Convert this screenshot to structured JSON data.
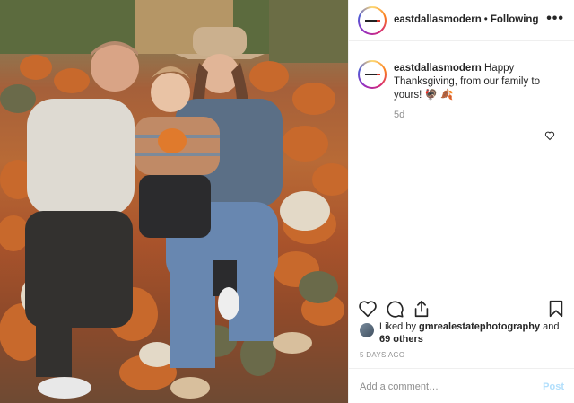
{
  "post": {
    "photo_alt": "family photo in pumpkin patch",
    "header": {
      "username": "eastdallasmodern",
      "separator": "•",
      "follow_status": "Following",
      "more_label": "•••"
    },
    "caption": {
      "username": "eastdallasmodern",
      "text": "Happy Thanksgiving, from our family to yours! 🦃 🍂",
      "age": "5d"
    },
    "likes": {
      "prefix": "Liked by ",
      "liker": "gmrealestatephotography",
      "mid": " and",
      "others": "69 others"
    },
    "time_ago": "5 DAYS AGO",
    "comment": {
      "placeholder": "Add a comment…",
      "post_label": "Post"
    }
  },
  "icons": {
    "more": "more-dots-icon",
    "like": "heart-icon",
    "comment": "comment-bubble-icon",
    "share": "share-icon",
    "save": "bookmark-icon"
  },
  "colors": {
    "text": "#262626",
    "secondary": "#8e8e8e",
    "post_button": "#b2dffc",
    "divider": "#efefef"
  }
}
